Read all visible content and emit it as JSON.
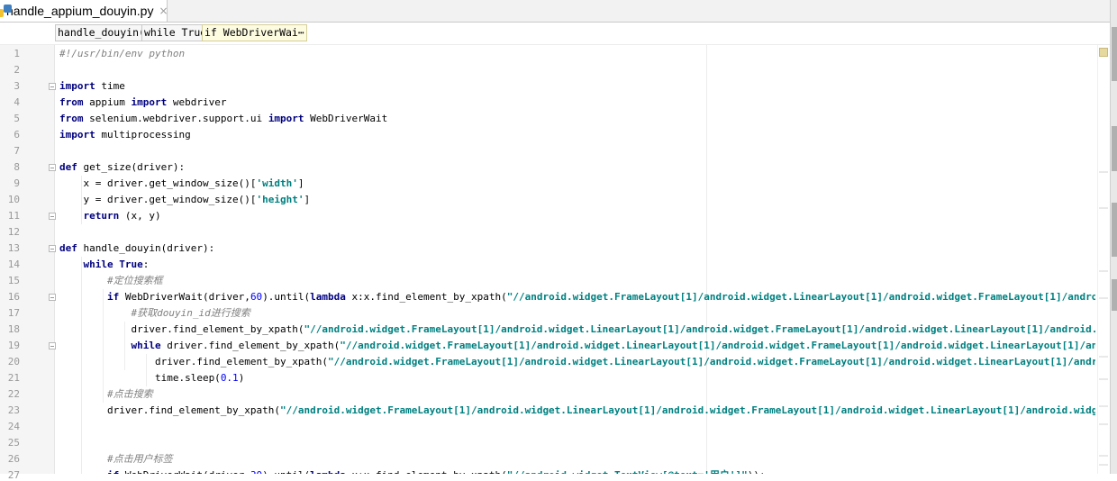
{
  "editor_tab": {
    "title": "handle_appium_douyin.py",
    "close_glyph": "×",
    "icon": "python-file-icon"
  },
  "breadcrumbs": [
    "handle_douyin()",
    "while True",
    "if WebDriverWai⋯"
  ],
  "code_lines": [
    "#!/usr/bin/env python",
    "",
    "import time",
    "from appium import webdriver",
    "from selenium.webdriver.support.ui import WebDriverWait",
    "import multiprocessing",
    "",
    "def get_size(driver):",
    "    x = driver.get_window_size()['width']",
    "    y = driver.get_window_size()['height']",
    "    return (x, y)",
    "",
    "def handle_douyin(driver):",
    "    while True:",
    "        #定位搜索框",
    "        if WebDriverWait(driver,60).until(lambda x:x.find_element_by_xpath(\"//android.widget.FrameLayout[1]/android.widget.LinearLayout[1]/android.widget.FrameLayout[1]/android.widget.L",
    "            #获取douyin_id进行搜索",
    "            driver.find_element_by_xpath(\"//android.widget.FrameLayout[1]/android.widget.LinearLayout[1]/android.widget.FrameLayout[1]/android.widget.LinearLayout[1]/android.widget.Fr",
    "            while driver.find_element_by_xpath(\"//android.widget.FrameLayout[1]/android.widget.LinearLayout[1]/android.widget.FrameLayout[1]/android.widget.LinearLayout[1]/android.wid",
    "                driver.find_element_by_xpath(\"//android.widget.FrameLayout[1]/android.widget.LinearLayout[1]/android.widget.FrameLayout[1]/android.widget.LinearLayout[1]/android.widge",
    "                time.sleep(0.1)",
    "        #点击搜索",
    "        driver.find_element_by_xpath(\"//android.widget.FrameLayout[1]/android.widget.LinearLayout[1]/android.widget.FrameLayout[1]/android.widget.LinearLayout[1]/android.widget.FrameL",
    "",
    "",
    "        #点击用户标签",
    "        if WebDriverWait(driver,30).until(lambda x:x.find_element_by_xpath(\"//android.widget.TextView[@text='用户']\")):"
  ],
  "colors": {
    "keyword": "#000080",
    "string": "#008080",
    "number": "#0000ff",
    "comment": "#808080",
    "line_number": "#999999",
    "gutter": "#f5f5f5"
  }
}
